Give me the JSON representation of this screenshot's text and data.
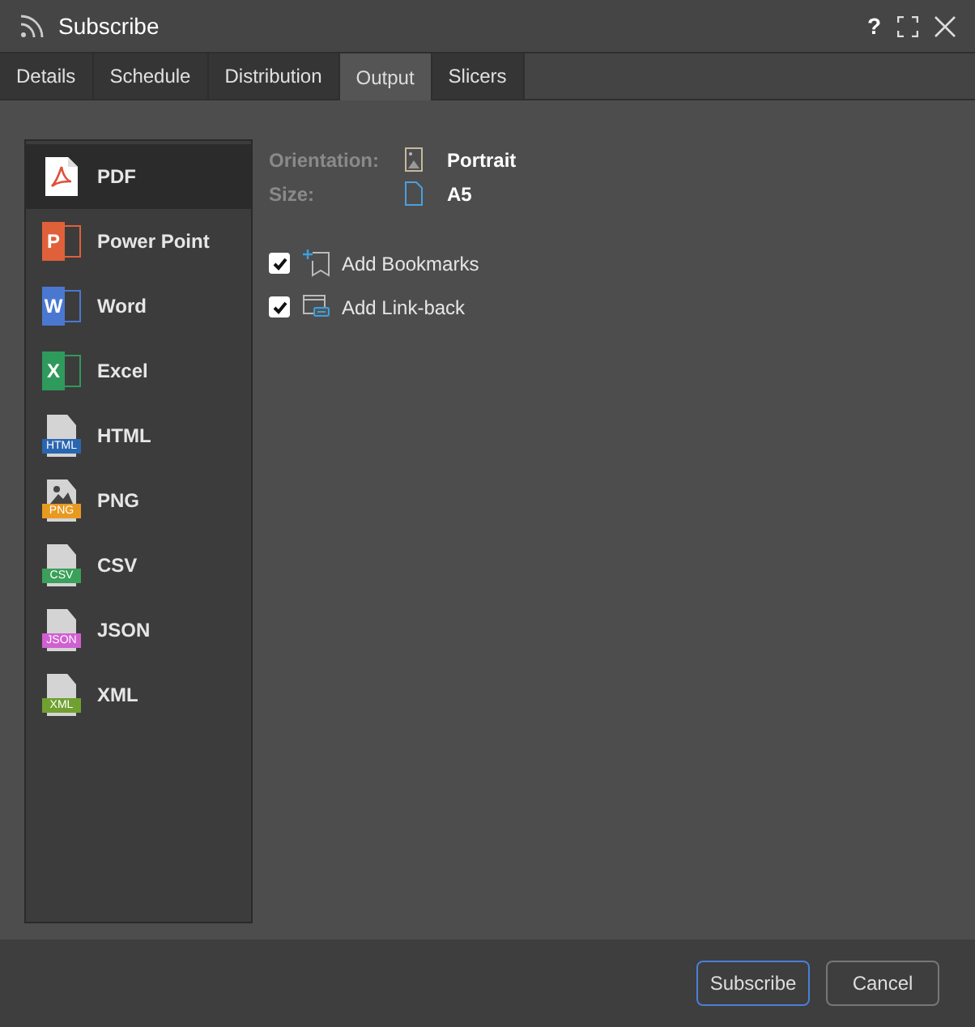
{
  "window": {
    "title": "Subscribe",
    "controls": [
      "?"
    ]
  },
  "tabs": [
    {
      "label": "Details",
      "selected": false
    },
    {
      "label": "Schedule",
      "selected": false
    },
    {
      "label": "Distribution",
      "selected": false
    },
    {
      "label": "Output",
      "selected": true
    },
    {
      "label": "Slicers",
      "selected": false
    }
  ],
  "formats": [
    {
      "label": "PDF",
      "kind": "pdf",
      "selected": true
    },
    {
      "label": "Power Point",
      "kind": "office",
      "badge": "P",
      "color": "#e0603a",
      "selected": false
    },
    {
      "label": "Word",
      "kind": "office",
      "badge": "W",
      "color": "#4a78d0",
      "selected": false
    },
    {
      "label": "Excel",
      "kind": "office",
      "badge": "X",
      "color": "#2e9a5c",
      "selected": false
    },
    {
      "label": "HTML",
      "kind": "file",
      "badge": "HTML",
      "color": "#2a66b0",
      "selected": false
    },
    {
      "label": "PNG",
      "kind": "image",
      "badge": "PNG",
      "color": "#e89a20",
      "selected": false
    },
    {
      "label": "CSV",
      "kind": "file",
      "badge": "CSV",
      "color": "#3aa05a",
      "selected": false
    },
    {
      "label": "JSON",
      "kind": "file",
      "badge": "JSON",
      "color": "#d060d0",
      "selected": false
    },
    {
      "label": "XML",
      "kind": "file",
      "badge": "XML",
      "color": "#70a030",
      "selected": false
    }
  ],
  "settings": [
    {
      "label": "Orientation:",
      "kind": "orientation",
      "value": "Portrait"
    },
    {
      "label": "Size:",
      "kind": "size",
      "value": "A5"
    }
  ],
  "options": [
    {
      "label": "Add Bookmarks",
      "kind": "bookmark",
      "checked": true
    },
    {
      "label": "Add Link-back",
      "kind": "link",
      "checked": true
    }
  ],
  "buttons": [
    {
      "label": "Subscribe",
      "primary": true
    },
    {
      "label": "Cancel",
      "primary": false
    }
  ]
}
